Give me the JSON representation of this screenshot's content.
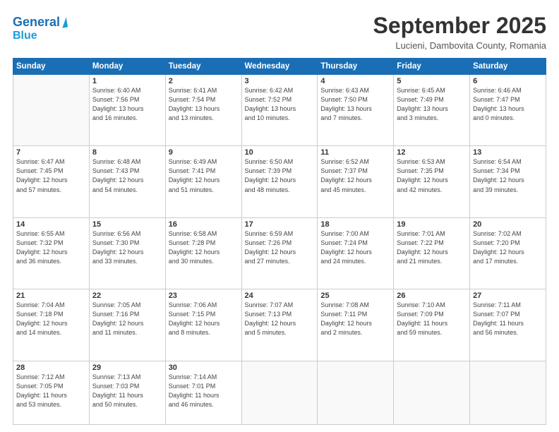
{
  "logo": {
    "line1": "General",
    "line2": "Blue"
  },
  "title": "September 2025",
  "location": "Lucieni, Dambovita County, Romania",
  "weekdays": [
    "Sunday",
    "Monday",
    "Tuesday",
    "Wednesday",
    "Thursday",
    "Friday",
    "Saturday"
  ],
  "weeks": [
    [
      {
        "day": "",
        "detail": ""
      },
      {
        "day": "1",
        "detail": "Sunrise: 6:40 AM\nSunset: 7:56 PM\nDaylight: 13 hours\nand 16 minutes."
      },
      {
        "day": "2",
        "detail": "Sunrise: 6:41 AM\nSunset: 7:54 PM\nDaylight: 13 hours\nand 13 minutes."
      },
      {
        "day": "3",
        "detail": "Sunrise: 6:42 AM\nSunset: 7:52 PM\nDaylight: 13 hours\nand 10 minutes."
      },
      {
        "day": "4",
        "detail": "Sunrise: 6:43 AM\nSunset: 7:50 PM\nDaylight: 13 hours\nand 7 minutes."
      },
      {
        "day": "5",
        "detail": "Sunrise: 6:45 AM\nSunset: 7:49 PM\nDaylight: 13 hours\nand 3 minutes."
      },
      {
        "day": "6",
        "detail": "Sunrise: 6:46 AM\nSunset: 7:47 PM\nDaylight: 13 hours\nand 0 minutes."
      }
    ],
    [
      {
        "day": "7",
        "detail": "Sunrise: 6:47 AM\nSunset: 7:45 PM\nDaylight: 12 hours\nand 57 minutes."
      },
      {
        "day": "8",
        "detail": "Sunrise: 6:48 AM\nSunset: 7:43 PM\nDaylight: 12 hours\nand 54 minutes."
      },
      {
        "day": "9",
        "detail": "Sunrise: 6:49 AM\nSunset: 7:41 PM\nDaylight: 12 hours\nand 51 minutes."
      },
      {
        "day": "10",
        "detail": "Sunrise: 6:50 AM\nSunset: 7:39 PM\nDaylight: 12 hours\nand 48 minutes."
      },
      {
        "day": "11",
        "detail": "Sunrise: 6:52 AM\nSunset: 7:37 PM\nDaylight: 12 hours\nand 45 minutes."
      },
      {
        "day": "12",
        "detail": "Sunrise: 6:53 AM\nSunset: 7:35 PM\nDaylight: 12 hours\nand 42 minutes."
      },
      {
        "day": "13",
        "detail": "Sunrise: 6:54 AM\nSunset: 7:34 PM\nDaylight: 12 hours\nand 39 minutes."
      }
    ],
    [
      {
        "day": "14",
        "detail": "Sunrise: 6:55 AM\nSunset: 7:32 PM\nDaylight: 12 hours\nand 36 minutes."
      },
      {
        "day": "15",
        "detail": "Sunrise: 6:56 AM\nSunset: 7:30 PM\nDaylight: 12 hours\nand 33 minutes."
      },
      {
        "day": "16",
        "detail": "Sunrise: 6:58 AM\nSunset: 7:28 PM\nDaylight: 12 hours\nand 30 minutes."
      },
      {
        "day": "17",
        "detail": "Sunrise: 6:59 AM\nSunset: 7:26 PM\nDaylight: 12 hours\nand 27 minutes."
      },
      {
        "day": "18",
        "detail": "Sunrise: 7:00 AM\nSunset: 7:24 PM\nDaylight: 12 hours\nand 24 minutes."
      },
      {
        "day": "19",
        "detail": "Sunrise: 7:01 AM\nSunset: 7:22 PM\nDaylight: 12 hours\nand 21 minutes."
      },
      {
        "day": "20",
        "detail": "Sunrise: 7:02 AM\nSunset: 7:20 PM\nDaylight: 12 hours\nand 17 minutes."
      }
    ],
    [
      {
        "day": "21",
        "detail": "Sunrise: 7:04 AM\nSunset: 7:18 PM\nDaylight: 12 hours\nand 14 minutes."
      },
      {
        "day": "22",
        "detail": "Sunrise: 7:05 AM\nSunset: 7:16 PM\nDaylight: 12 hours\nand 11 minutes."
      },
      {
        "day": "23",
        "detail": "Sunrise: 7:06 AM\nSunset: 7:15 PM\nDaylight: 12 hours\nand 8 minutes."
      },
      {
        "day": "24",
        "detail": "Sunrise: 7:07 AM\nSunset: 7:13 PM\nDaylight: 12 hours\nand 5 minutes."
      },
      {
        "day": "25",
        "detail": "Sunrise: 7:08 AM\nSunset: 7:11 PM\nDaylight: 12 hours\nand 2 minutes."
      },
      {
        "day": "26",
        "detail": "Sunrise: 7:10 AM\nSunset: 7:09 PM\nDaylight: 11 hours\nand 59 minutes."
      },
      {
        "day": "27",
        "detail": "Sunrise: 7:11 AM\nSunset: 7:07 PM\nDaylight: 11 hours\nand 56 minutes."
      }
    ],
    [
      {
        "day": "28",
        "detail": "Sunrise: 7:12 AM\nSunset: 7:05 PM\nDaylight: 11 hours\nand 53 minutes."
      },
      {
        "day": "29",
        "detail": "Sunrise: 7:13 AM\nSunset: 7:03 PM\nDaylight: 11 hours\nand 50 minutes."
      },
      {
        "day": "30",
        "detail": "Sunrise: 7:14 AM\nSunset: 7:01 PM\nDaylight: 11 hours\nand 46 minutes."
      },
      {
        "day": "",
        "detail": ""
      },
      {
        "day": "",
        "detail": ""
      },
      {
        "day": "",
        "detail": ""
      },
      {
        "day": "",
        "detail": ""
      }
    ]
  ]
}
